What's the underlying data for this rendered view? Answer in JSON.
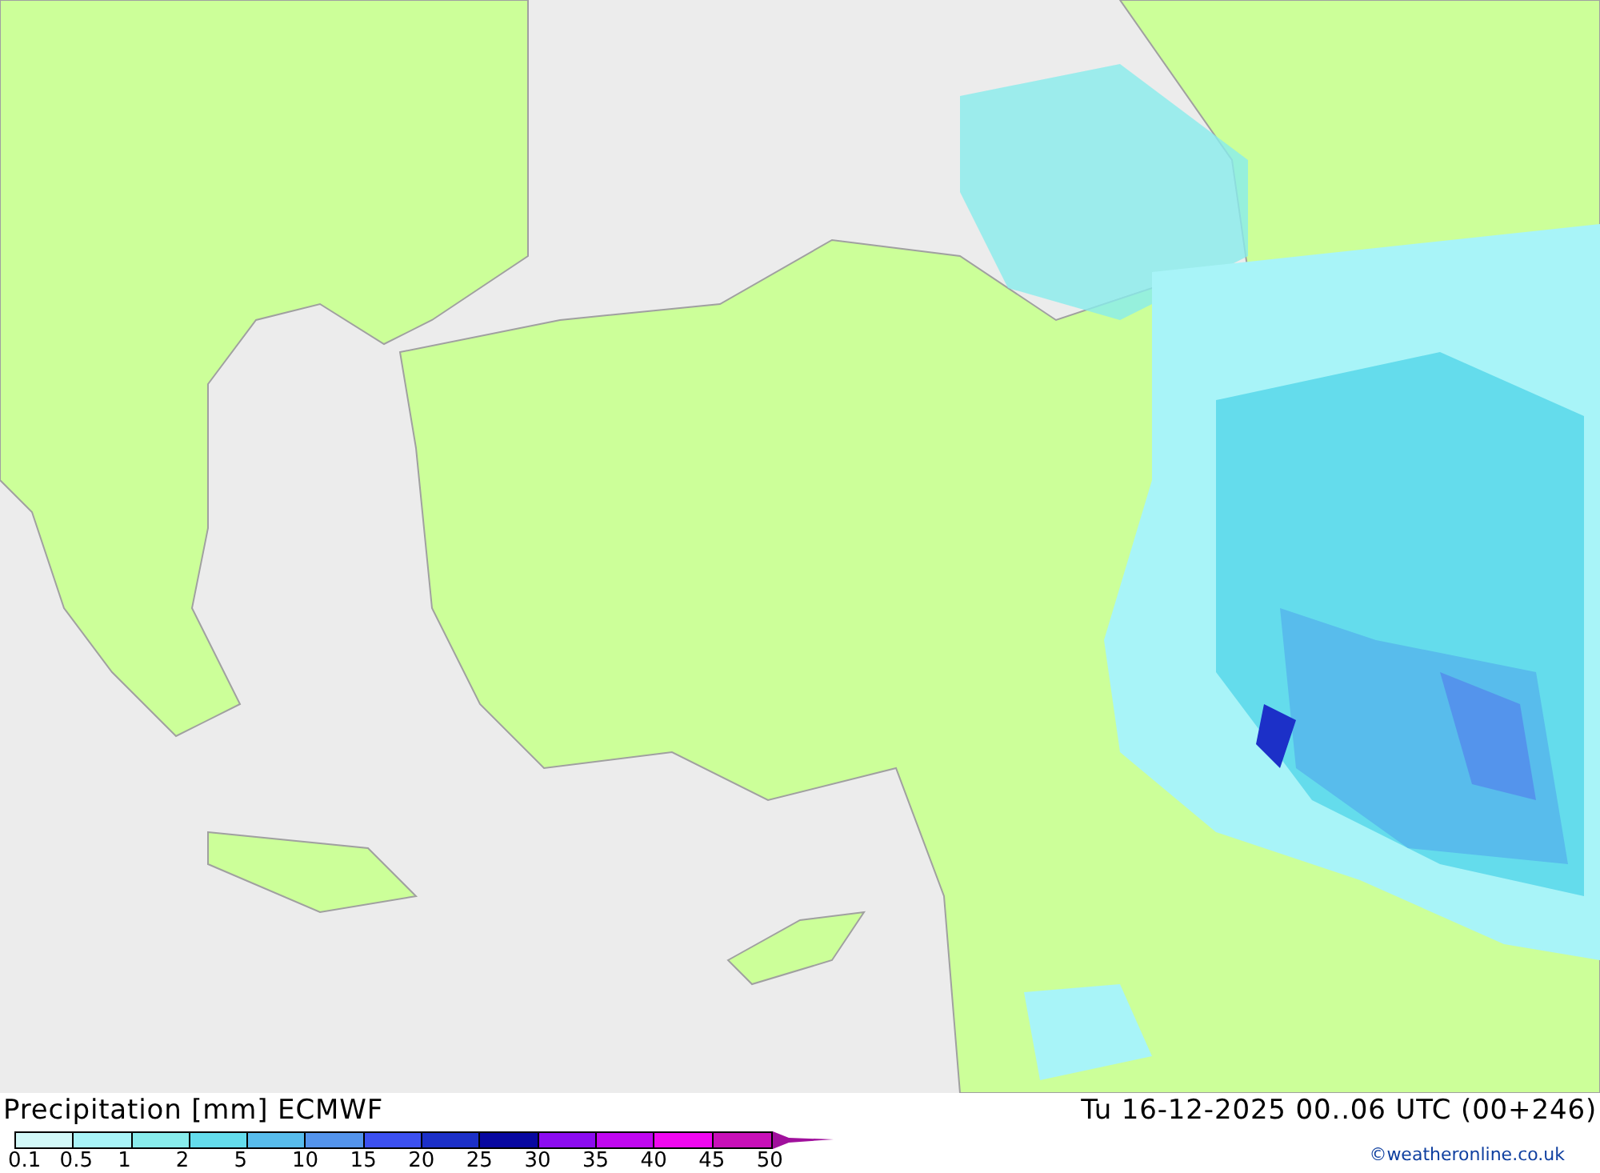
{
  "title": "Precipitation [mm] ECMWF",
  "valid_time": "Tu 16-12-2025 00..06 UTC (00+246)",
  "credit": "©weatheronline.co.uk",
  "legend": {
    "bins": [
      {
        "color": "#d2f8f8"
      },
      {
        "color": "#a8f4f8"
      },
      {
        "color": "#88ecec"
      },
      {
        "color": "#64dcec"
      },
      {
        "color": "#58bcec"
      },
      {
        "color": "#5494ec"
      },
      {
        "color": "#3c50f0"
      },
      {
        "color": "#1c30c8"
      },
      {
        "color": "#0808a0"
      },
      {
        "color": "#8c0cf0"
      },
      {
        "color": "#c008f0"
      },
      {
        "color": "#f008f0"
      },
      {
        "color": "#c810b8"
      }
    ],
    "labels": [
      "0.1",
      "0.5",
      "1",
      "2",
      "5",
      "10",
      "15",
      "20",
      "25",
      "30",
      "35",
      "40",
      "45",
      "50"
    ]
  }
}
